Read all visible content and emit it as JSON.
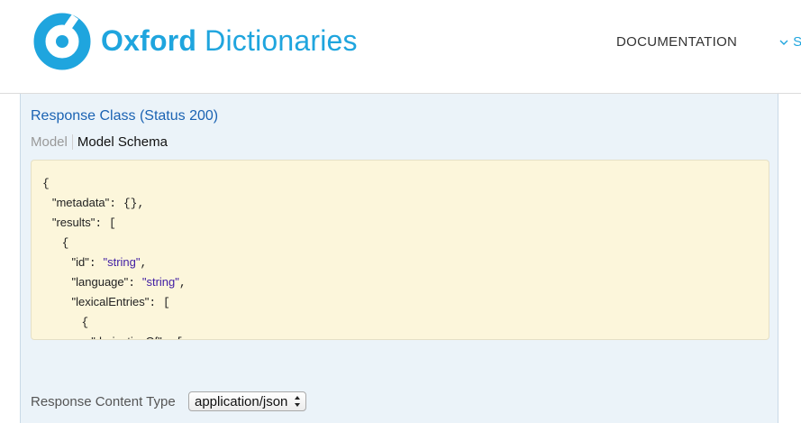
{
  "header": {
    "brand_bold": "Oxford",
    "brand_light": " Dictionaries",
    "nav": {
      "documentation_label": "DOCUMENTATION",
      "more_label": "S"
    },
    "colors": {
      "brand": "#1fa5de"
    }
  },
  "response": {
    "title": "Response Class (Status 200)",
    "tabs": {
      "model": "Model",
      "schema": "Model Schema"
    },
    "schema_lines": [
      {
        "indent": "",
        "parts": [
          {
            "t": "{",
            "k": "punc"
          }
        ]
      },
      {
        "indent": "   ",
        "parts": [
          {
            "t": "\"metadata\"",
            "k": "key"
          },
          {
            "t": ": {},",
            "k": "punc"
          }
        ]
      },
      {
        "indent": "   ",
        "parts": [
          {
            "t": "\"results\"",
            "k": "key"
          },
          {
            "t": ": [",
            "k": "punc"
          }
        ]
      },
      {
        "indent": "      ",
        "parts": [
          {
            "t": "{",
            "k": "punc"
          }
        ]
      },
      {
        "indent": "         ",
        "parts": [
          {
            "t": "\"id\"",
            "k": "key"
          },
          {
            "t": ": ",
            "k": "punc"
          },
          {
            "t": "\"string\"",
            "k": "str"
          },
          {
            "t": ",",
            "k": "punc"
          }
        ]
      },
      {
        "indent": "         ",
        "parts": [
          {
            "t": "\"language\"",
            "k": "key"
          },
          {
            "t": ": ",
            "k": "punc"
          },
          {
            "t": "\"string\"",
            "k": "str"
          },
          {
            "t": ",",
            "k": "punc"
          }
        ]
      },
      {
        "indent": "         ",
        "parts": [
          {
            "t": "\"lexicalEntries\"",
            "k": "key"
          },
          {
            "t": ": [",
            "k": "punc"
          }
        ]
      },
      {
        "indent": "            ",
        "parts": [
          {
            "t": "{",
            "k": "punc"
          }
        ]
      },
      {
        "indent": "               ",
        "parts": [
          {
            "t": "\"derivativeOf\"",
            "k": "key"
          },
          {
            "t": ": [",
            "k": "punc"
          }
        ]
      }
    ]
  },
  "content_type": {
    "label": "Response Content Type",
    "selected": "application/json"
  }
}
